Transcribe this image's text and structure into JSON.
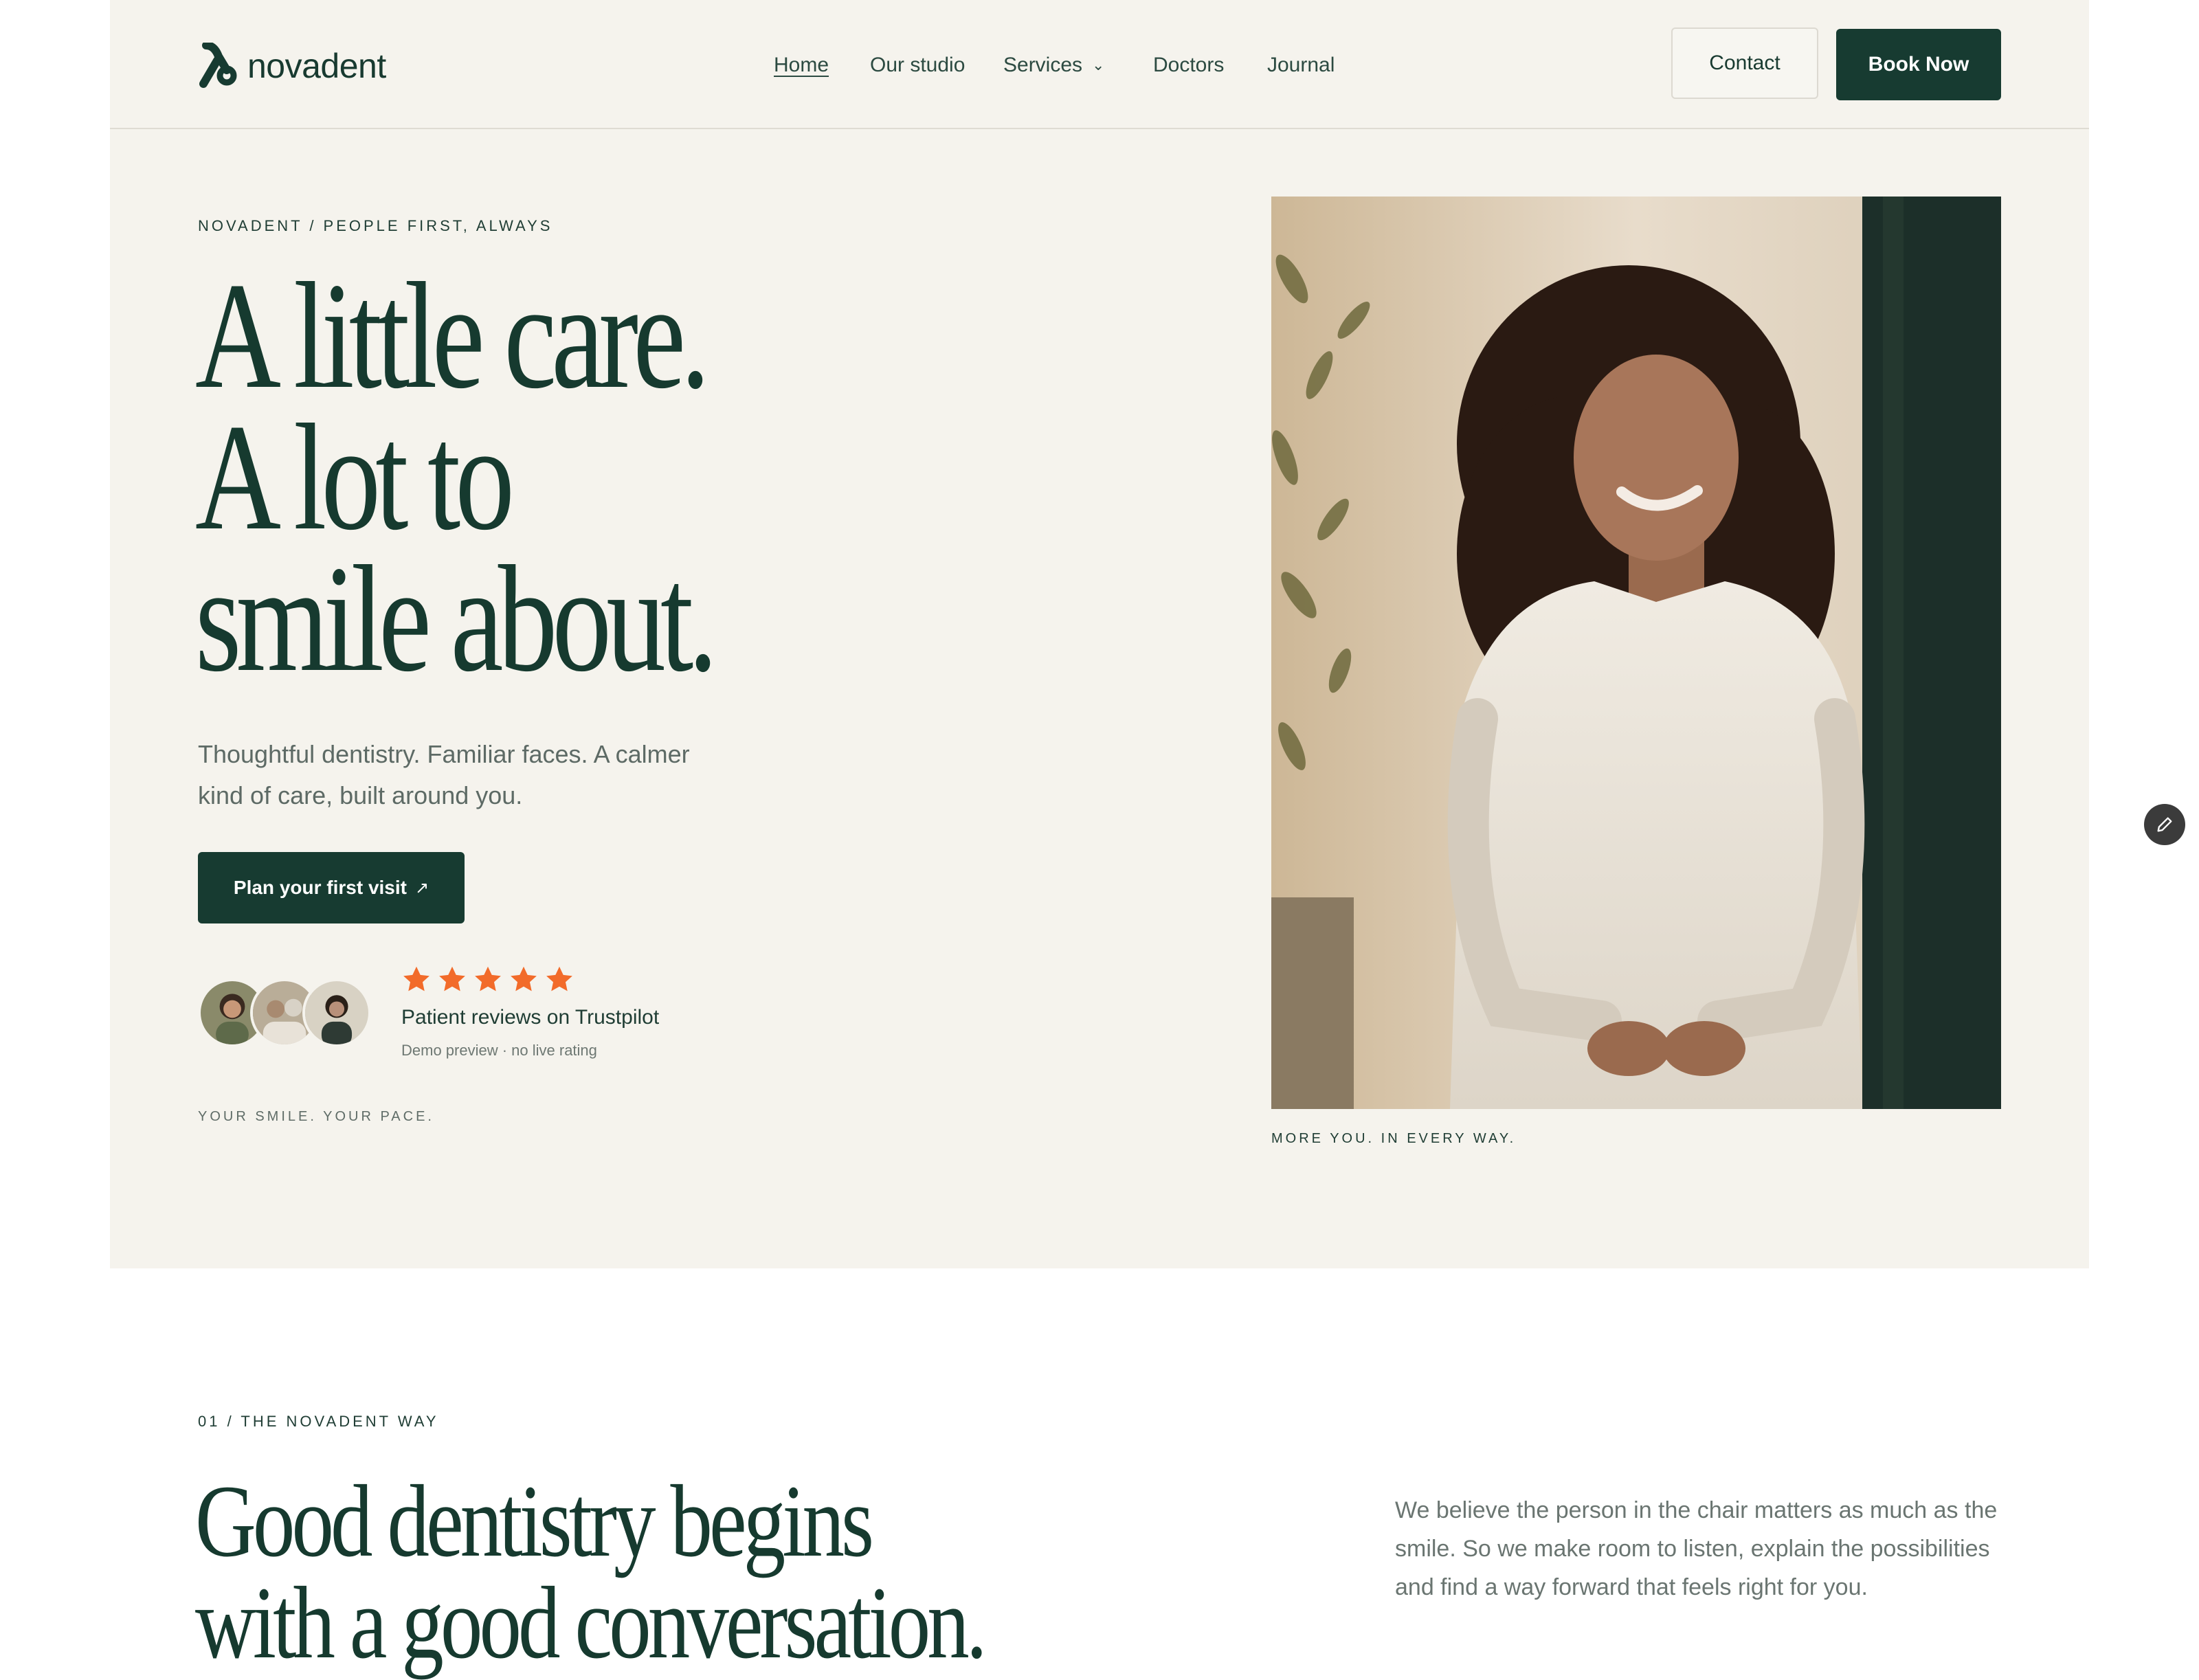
{
  "header": {
    "logo_text": "novadent",
    "nav": [
      {
        "label": "Home",
        "active": true
      },
      {
        "label": "Our studio"
      },
      {
        "label": "Services",
        "has_dropdown": true
      },
      {
        "label": "Doctors"
      },
      {
        "label": "Journal"
      }
    ],
    "contact_label": "Contact",
    "book_label": "Book Now"
  },
  "hero": {
    "eyebrow": "NOVADENT  /  PEOPLE FIRST, ALWAYS",
    "title_lines": [
      "A little care.",
      "A lot to",
      "smile about."
    ],
    "subtitle": "Thoughtful dentistry. Familiar faces. A calmer kind of care, built around you.",
    "cta_label": "Plan your first visit",
    "cta_icon": "arrow-up-right-icon",
    "rating_stars": 5,
    "review_title": "Patient reviews on Trustpilot",
    "review_note": "Demo preview · no live rating",
    "tagline_left": "YOUR SMILE. YOUR PACE.",
    "tagline_right": "MORE YOU. IN EVERY WAY.",
    "star_color": "#f26b2a"
  },
  "section_way": {
    "eyebrow": "01  /  THE NOVADENT WAY",
    "title_lines": [
      "Good dentistry begins",
      "with a good conversation."
    ],
    "body": "We believe the person in the chair matters as much as the smile. So we make room to listen, explain the possibilities and find a way forward that feels right for you."
  },
  "colors": {
    "brand_green": "#173b31",
    "hero_background": "#f5f3ed",
    "accent_orange": "#f26b2a"
  },
  "floating": {
    "edit_icon": "pencil-icon"
  }
}
